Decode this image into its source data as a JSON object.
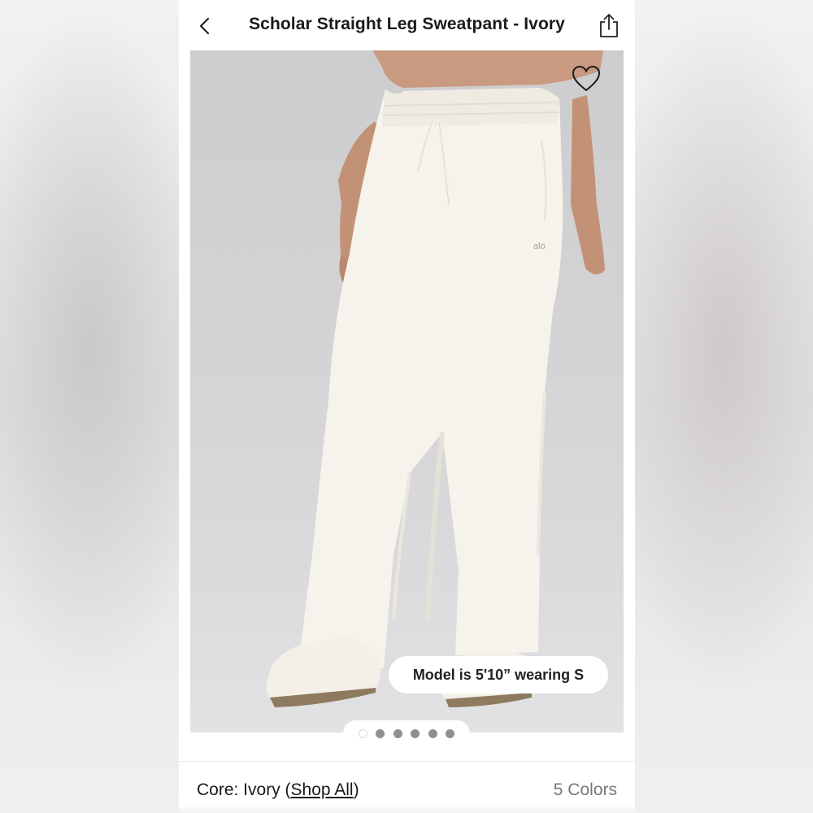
{
  "header": {
    "title": "Scholar Straight Leg Sweatpant - Ivory",
    "back_icon": "chevron-left-icon",
    "share_icon": "share-icon"
  },
  "hero": {
    "favorite_icon": "heart-icon",
    "model_info": "Model is 5'10” wearing S",
    "brand_mark": "alo",
    "carousel": {
      "count": 6,
      "active_index": 0
    }
  },
  "product": {
    "collection_prefix": "Core: Ivory (",
    "shop_all_label": "Shop All",
    "collection_suffix": ")",
    "colors_label": "5 Colors"
  },
  "colors": {
    "backdrop": "#cdcdcf",
    "garment": "#f6f3ec",
    "skin": "#c99a7f",
    "dot_inactive": "#8f8f8f"
  }
}
